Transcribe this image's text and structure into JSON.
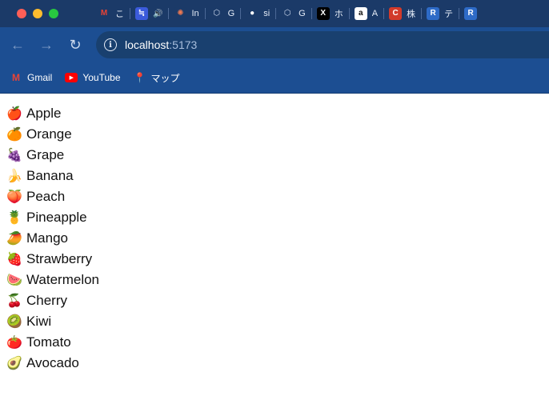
{
  "window": {
    "tabs": [
      {
        "icon": "gmail-icon",
        "title": "こ",
        "glyph": "M",
        "bg": "#1b3a68",
        "fg": "#ea4335"
      },
      {
        "icon": "audio-app-icon",
        "title": "",
        "glyph": "≒",
        "bg": "#3b5bdb",
        "fg": "#ffffff",
        "speaker": "🔊"
      },
      {
        "icon": "burst-icon",
        "title": "In",
        "glyph": "✺",
        "bg": "#1b3a68",
        "fg": "#f07a52"
      },
      {
        "icon": "hexagon-icon",
        "title": "G",
        "glyph": "⬡",
        "bg": "#1b3a68",
        "fg": "#d0dcf0"
      },
      {
        "icon": "github-icon",
        "title": "si",
        "glyph": "●",
        "bg": "#1b3a68",
        "fg": "#ffffff"
      },
      {
        "icon": "hexagon-icon",
        "title": "G",
        "glyph": "⬡",
        "bg": "#1b3a68",
        "fg": "#d0dcf0"
      },
      {
        "icon": "x-icon",
        "title": "ホ",
        "glyph": "X",
        "bg": "#000000",
        "fg": "#ffffff"
      },
      {
        "icon": "amazon-icon",
        "title": "A",
        "glyph": "a",
        "bg": "#ffffff",
        "fg": "#111111"
      },
      {
        "icon": "c-icon",
        "title": "株",
        "glyph": "C",
        "bg": "#d23a2a",
        "fg": "#ffffff"
      },
      {
        "icon": "r-icon",
        "title": "テ",
        "glyph": "R",
        "bg": "#2e6bc7",
        "fg": "#ffffff"
      },
      {
        "icon": "r-icon",
        "title": "",
        "glyph": "R",
        "bg": "#2e6bc7",
        "fg": "#ffffff"
      }
    ]
  },
  "address_bar": {
    "host": "localhost",
    "port": ":5173"
  },
  "bookmarks": [
    {
      "name": "bookmark-gmail",
      "icon": "gmail-icon",
      "label": "Gmail",
      "glyph": "M",
      "color": "#ea4335"
    },
    {
      "name": "bookmark-youtube",
      "icon": "youtube-icon",
      "label": "YouTube",
      "glyph": "▶",
      "color": "#ff0000"
    },
    {
      "name": "bookmark-maps",
      "icon": "maps-pin-icon",
      "label": "マップ",
      "glyph": "📍",
      "color": "#34a853"
    }
  ],
  "fruits": [
    {
      "emoji": "🍎",
      "label": "Apple"
    },
    {
      "emoji": "🍊",
      "label": "Orange"
    },
    {
      "emoji": "🍇",
      "label": "Grape"
    },
    {
      "emoji": "🍌",
      "label": "Banana"
    },
    {
      "emoji": "🍑",
      "label": "Peach"
    },
    {
      "emoji": "🍍",
      "label": "Pineapple"
    },
    {
      "emoji": "🥭",
      "label": "Mango"
    },
    {
      "emoji": "🍓",
      "label": "Strawberry"
    },
    {
      "emoji": "🍉",
      "label": "Watermelon"
    },
    {
      "emoji": "🍒",
      "label": "Cherry"
    },
    {
      "emoji": "🥝",
      "label": "Kiwi"
    },
    {
      "emoji": "🍅",
      "label": "Tomato"
    },
    {
      "emoji": "🥑",
      "label": "Avocado"
    }
  ]
}
